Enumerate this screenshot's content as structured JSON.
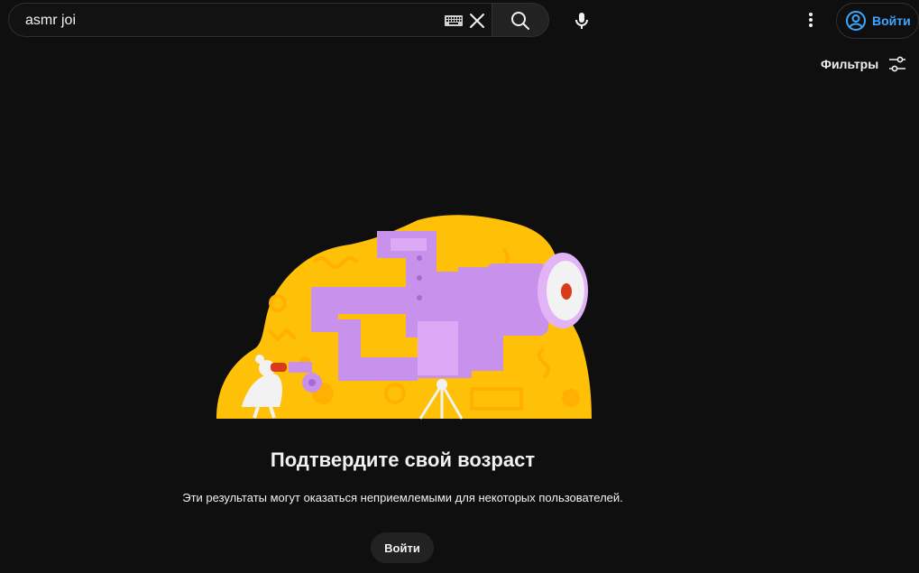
{
  "search": {
    "value": "asmr joi",
    "keyboard_icon": "keyboard-icon",
    "clear_icon": "close-icon",
    "search_icon": "search-icon"
  },
  "header": {
    "mic_icon": "microphone-icon",
    "more_icon": "more-vert-icon",
    "signin_label": "Войти",
    "signin_icon": "account-circle-icon"
  },
  "filters": {
    "label": "Фильтры",
    "icon": "sliders-icon"
  },
  "age_gate": {
    "heading": "Подтвердите свой возраст",
    "description": "Эти результаты могут оказаться неприемлемыми для некоторых пользователей.",
    "signin_label": "Войти"
  },
  "colors": {
    "background": "#0f0f0f",
    "accent_blue": "#3ea6ff",
    "illustration_yellow": "#ffc107",
    "illustration_purple": "#c891ec"
  }
}
